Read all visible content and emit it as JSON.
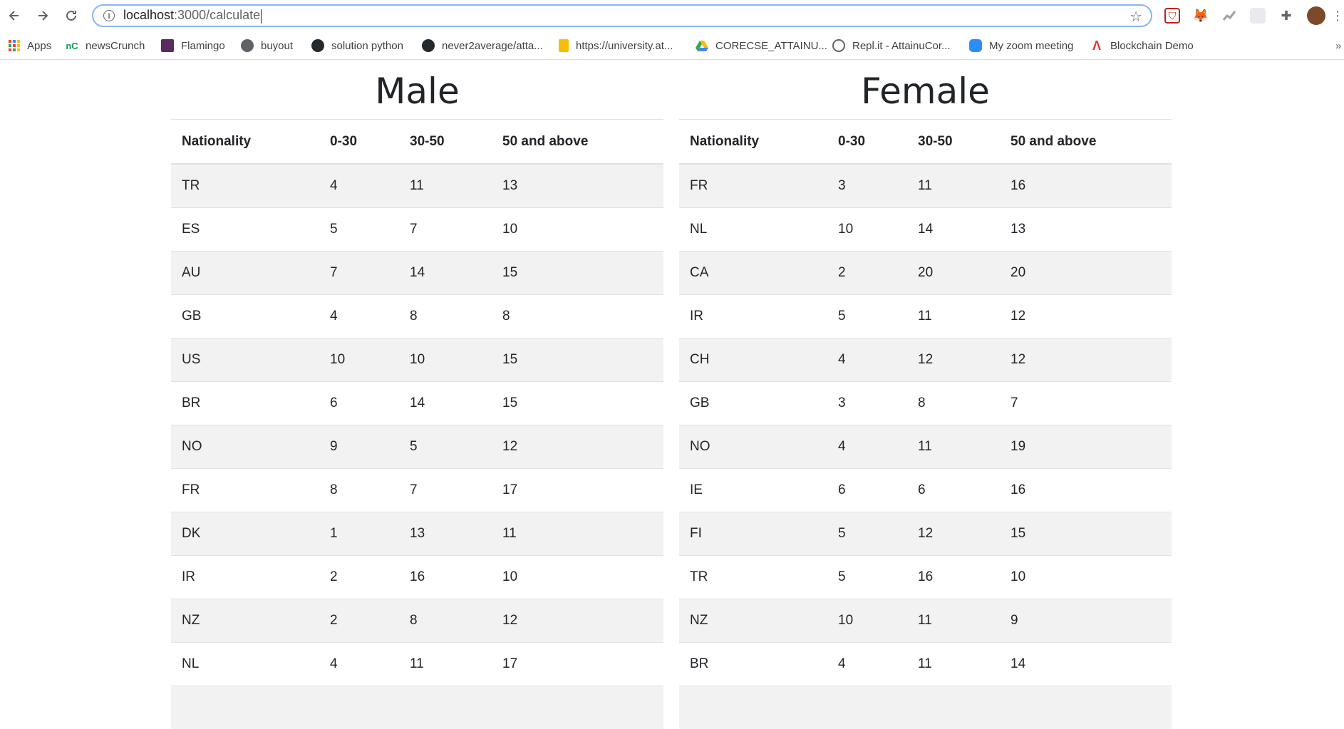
{
  "browser": {
    "url_host": "localhost",
    "url_rest": ":3000/calculate",
    "bookmarks": [
      {
        "label": "Apps",
        "icon": "apps-grid-icon"
      },
      {
        "label": "newsCrunch",
        "icon": "nc-logo-icon"
      },
      {
        "label": "Flamingo",
        "icon": "flamingo-icon"
      },
      {
        "label": "buyout",
        "icon": "globe-icon"
      },
      {
        "label": "solution python",
        "icon": "github-icon"
      },
      {
        "label": "never2average/atta...",
        "icon": "github-icon"
      },
      {
        "label": "https://university.at...",
        "icon": "doc-icon"
      },
      {
        "label": "CORECSE_ATTAINU...",
        "icon": "drive-icon"
      },
      {
        "label": "Repl.it - AttainuCor...",
        "icon": "replit-icon"
      },
      {
        "label": "My zoom meeting",
        "icon": "zoom-icon"
      },
      {
        "label": "Blockchain Demo",
        "icon": "blockchain-icon"
      }
    ]
  },
  "male": {
    "title": "Male",
    "headers": [
      "Nationality",
      "0-30",
      "30-50",
      "50 and above"
    ],
    "rows": [
      [
        "TR",
        "4",
        "11",
        "13"
      ],
      [
        "ES",
        "5",
        "7",
        "10"
      ],
      [
        "AU",
        "7",
        "14",
        "15"
      ],
      [
        "GB",
        "4",
        "8",
        "8"
      ],
      [
        "US",
        "10",
        "10",
        "15"
      ],
      [
        "BR",
        "6",
        "14",
        "15"
      ],
      [
        "NO",
        "9",
        "5",
        "12"
      ],
      [
        "FR",
        "8",
        "7",
        "17"
      ],
      [
        "DK",
        "1",
        "13",
        "11"
      ],
      [
        "IR",
        "2",
        "16",
        "10"
      ],
      [
        "NZ",
        "2",
        "8",
        "12"
      ],
      [
        "NL",
        "4",
        "11",
        "17"
      ]
    ]
  },
  "female": {
    "title": "Female",
    "headers": [
      "Nationality",
      "0-30",
      "30-50",
      "50 and above"
    ],
    "rows": [
      [
        "FR",
        "3",
        "11",
        "16"
      ],
      [
        "NL",
        "10",
        "14",
        "13"
      ],
      [
        "CA",
        "2",
        "20",
        "20"
      ],
      [
        "IR",
        "5",
        "11",
        "12"
      ],
      [
        "CH",
        "4",
        "12",
        "12"
      ],
      [
        "GB",
        "3",
        "8",
        "7"
      ],
      [
        "NO",
        "4",
        "11",
        "19"
      ],
      [
        "IE",
        "6",
        "6",
        "16"
      ],
      [
        "FI",
        "5",
        "12",
        "15"
      ],
      [
        "TR",
        "5",
        "16",
        "10"
      ],
      [
        "NZ",
        "10",
        "11",
        "9"
      ],
      [
        "BR",
        "4",
        "11",
        "14"
      ]
    ]
  }
}
